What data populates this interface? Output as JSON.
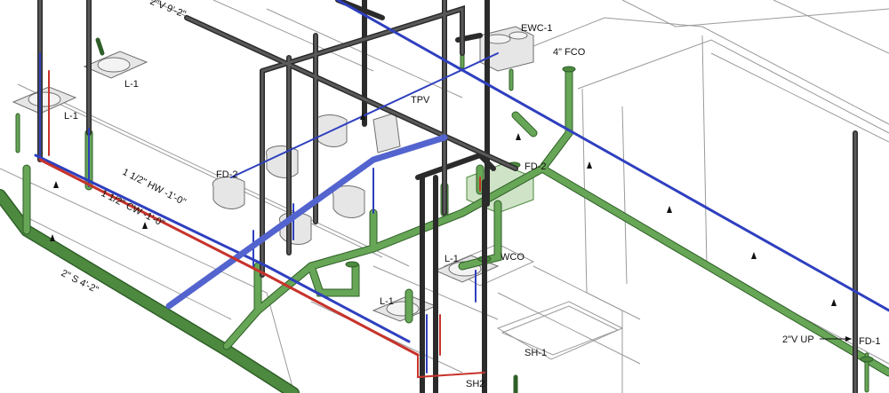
{
  "labels": {
    "top_v": "2\"V  9'-2\"",
    "ewc1": "EWC-1",
    "fco": "4\" FCO",
    "l1_top": "L-1",
    "l1_left": "L-1",
    "tpv": "TPV",
    "fd2_left": "FD-2",
    "fd2_right": "FD-2",
    "hw": "1 1/2\" HW -1'-0\"",
    "cw": "1 1/2\" CW -1'-0\"",
    "sanitary": "2\" S  4'-2\"",
    "l1_mid": "L-1",
    "wco": "WCO",
    "l1_bottom": "L-1",
    "sh1": "SH-1",
    "sh2": "SH2",
    "v_up": "2\"V UP",
    "fd1": "FD-1"
  },
  "colors": {
    "sanitary_pipe": "#4d8a3f",
    "sanitary_dark": "#2f5f28",
    "vent_pipe": "#3b3b3b",
    "cold_water": "#2e3fbf",
    "hot_water": "#c7332b",
    "linework": "#9a9a9a"
  }
}
